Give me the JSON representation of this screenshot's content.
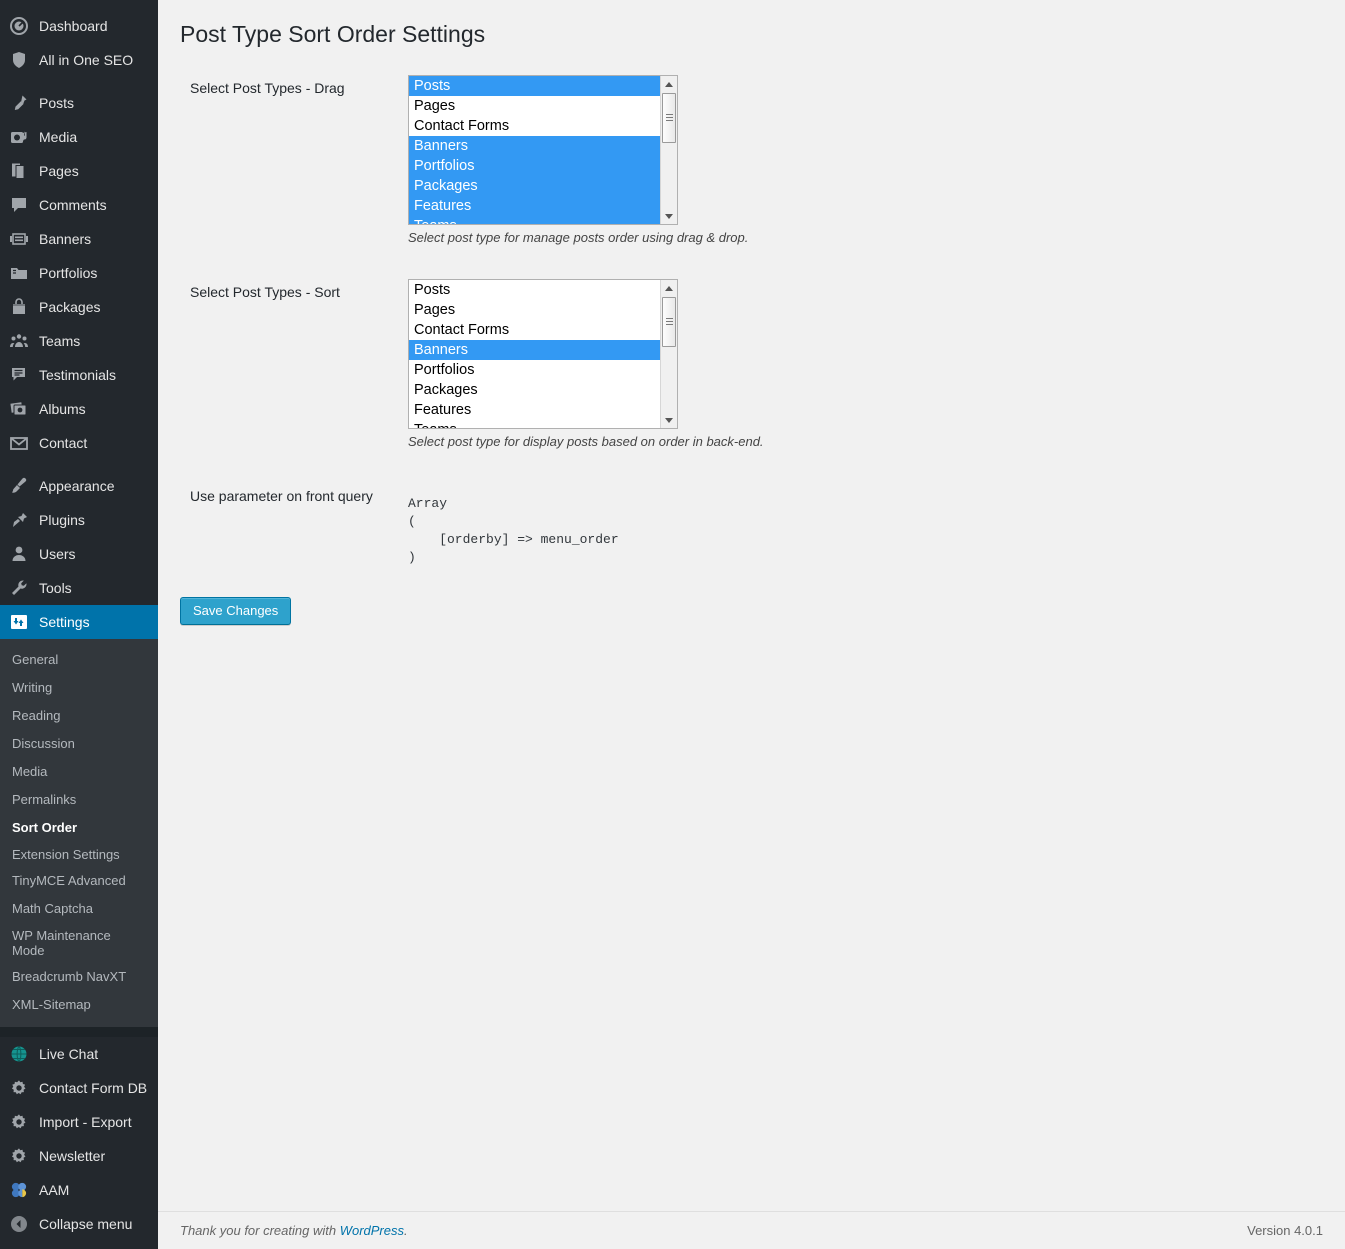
{
  "sidebar": {
    "top_items": [
      {
        "label": "Dashboard",
        "icon": "dashboard-icon"
      },
      {
        "label": "All in One SEO",
        "icon": "shield-icon"
      }
    ],
    "content_items": [
      {
        "label": "Posts",
        "icon": "pushpin-icon"
      },
      {
        "label": "Media",
        "icon": "media-icon"
      },
      {
        "label": "Pages",
        "icon": "pages-icon"
      },
      {
        "label": "Comments",
        "icon": "comment-icon"
      },
      {
        "label": "Banners",
        "icon": "banner-icon"
      },
      {
        "label": "Portfolios",
        "icon": "portfolio-folder-icon"
      },
      {
        "label": "Packages",
        "icon": "package-bag-icon"
      },
      {
        "label": "Teams",
        "icon": "groups-icon"
      },
      {
        "label": "Testimonials",
        "icon": "testimonial-icon"
      },
      {
        "label": "Albums",
        "icon": "albums-icon"
      },
      {
        "label": "Contact",
        "icon": "envelope-icon"
      }
    ],
    "admin_items": [
      {
        "label": "Appearance",
        "icon": "paintbrush-icon"
      },
      {
        "label": "Plugins",
        "icon": "plugin-icon"
      },
      {
        "label": "Users",
        "icon": "user-icon"
      },
      {
        "label": "Tools",
        "icon": "wrench-icon"
      }
    ],
    "settings_item": {
      "label": "Settings",
      "icon": "settings-gear-icon",
      "current": true
    },
    "settings_submenu": [
      {
        "label": "General",
        "current": false
      },
      {
        "label": "Writing",
        "current": false
      },
      {
        "label": "Reading",
        "current": false
      },
      {
        "label": "Discussion",
        "current": false
      },
      {
        "label": "Media",
        "current": false
      },
      {
        "label": "Permalinks",
        "current": false
      },
      {
        "label": "Sort Order",
        "current": true
      },
      {
        "label": "Extension Settings",
        "current": false
      },
      {
        "label": "TinyMCE Advanced",
        "current": false
      },
      {
        "label": "Math Captcha",
        "current": false
      },
      {
        "label": "WP Maintenance Mode",
        "current": false
      },
      {
        "label": "Breadcrumb NavXT",
        "current": false
      },
      {
        "label": "XML-Sitemap",
        "current": false
      }
    ],
    "plugin_items": [
      {
        "label": "Live Chat",
        "icon": "globe-icon"
      },
      {
        "label": "Contact Form DB",
        "icon": "gear-icon"
      },
      {
        "label": "Import - Export",
        "icon": "gear-icon"
      },
      {
        "label": "Newsletter",
        "icon": "gear-icon"
      },
      {
        "label": "AAM",
        "icon": "aam-icon"
      }
    ],
    "collapse": {
      "label": "Collapse menu",
      "icon": "collapse-arrow-icon"
    }
  },
  "page": {
    "title": "Post Type Sort Order Settings"
  },
  "fields": {
    "drag": {
      "label": "Select Post Types - Drag",
      "description": "Select post type for manage posts order using drag & drop.",
      "options": [
        {
          "label": "Posts",
          "selected": true
        },
        {
          "label": "Pages",
          "selected": false
        },
        {
          "label": "Contact Forms",
          "selected": false
        },
        {
          "label": "Banners",
          "selected": true
        },
        {
          "label": "Portfolios",
          "selected": true
        },
        {
          "label": "Packages",
          "selected": true
        },
        {
          "label": "Features",
          "selected": true
        },
        {
          "label": "Teams",
          "selected": true
        }
      ]
    },
    "sort": {
      "label": "Select Post Types - Sort",
      "description": "Select post type for display posts based on order in back-end.",
      "options": [
        {
          "label": "Posts",
          "selected": false
        },
        {
          "label": "Pages",
          "selected": false
        },
        {
          "label": "Contact Forms",
          "selected": false
        },
        {
          "label": "Banners",
          "selected": true
        },
        {
          "label": "Portfolios",
          "selected": false
        },
        {
          "label": "Packages",
          "selected": false
        },
        {
          "label": "Features",
          "selected": false
        },
        {
          "label": "Teams",
          "selected": false
        }
      ]
    },
    "front_query": {
      "label": "Use parameter on front query",
      "code": "Array\n(\n    [orderby] => menu_order\n)"
    }
  },
  "submit": {
    "save_label": "Save Changes"
  },
  "footer": {
    "thanks_prefix": "Thank you for creating with ",
    "wordpress_link": "WordPress",
    "thanks_suffix": ".",
    "version": "Version 4.0.1"
  },
  "colors": {
    "sidebar_bg": "#23282d",
    "submenu_bg": "#32373c",
    "current_menu": "#0073aa",
    "select_highlight": "#3399f3",
    "button_primary": "#2ea2cc",
    "link": "#0073aa"
  }
}
